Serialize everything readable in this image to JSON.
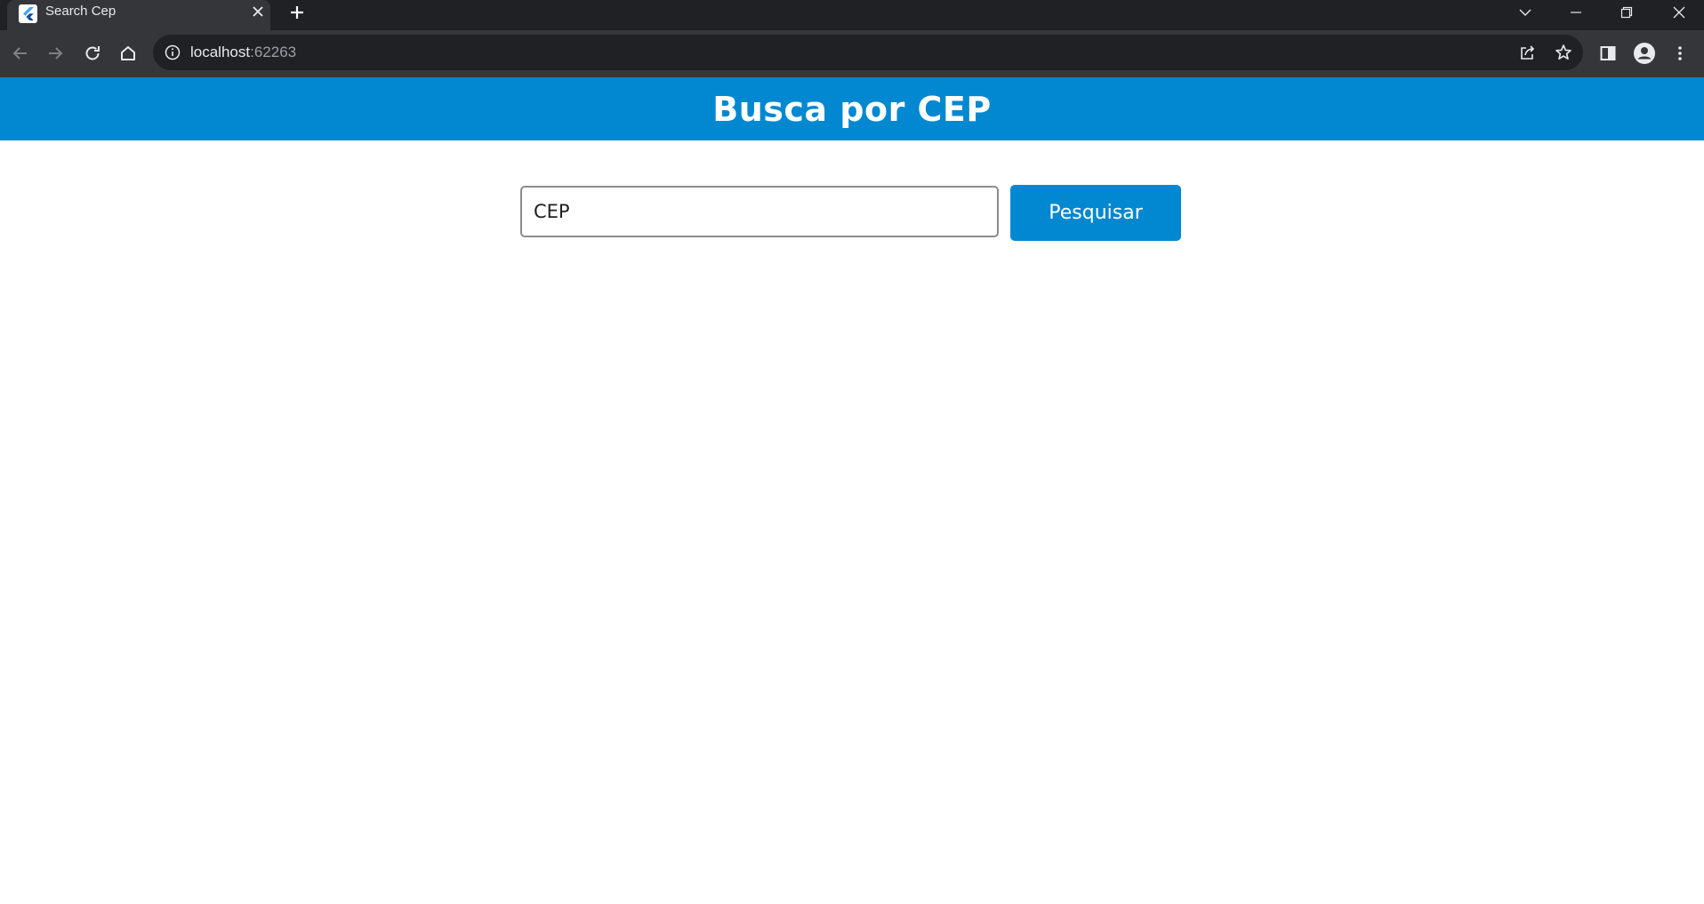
{
  "browser": {
    "tab": {
      "title": "Search Cep",
      "favicon": "flutter-icon"
    },
    "address": {
      "host": "localhost",
      "port": ":62263"
    },
    "icons": {
      "back": "back-arrow-icon",
      "forward": "forward-arrow-icon",
      "reload": "reload-icon",
      "home": "home-icon",
      "site_info": "info-icon",
      "share": "share-icon",
      "bookmark": "star-icon",
      "side_panel": "side-panel-icon",
      "profile": "profile-icon",
      "menu": "kebab-menu-icon"
    }
  },
  "app": {
    "title": "Busca por CEP",
    "colors": {
      "primary": "#0288d1"
    }
  },
  "form": {
    "cep_placeholder": "CEP",
    "cep_value": "",
    "search_label": "Pesquisar"
  }
}
